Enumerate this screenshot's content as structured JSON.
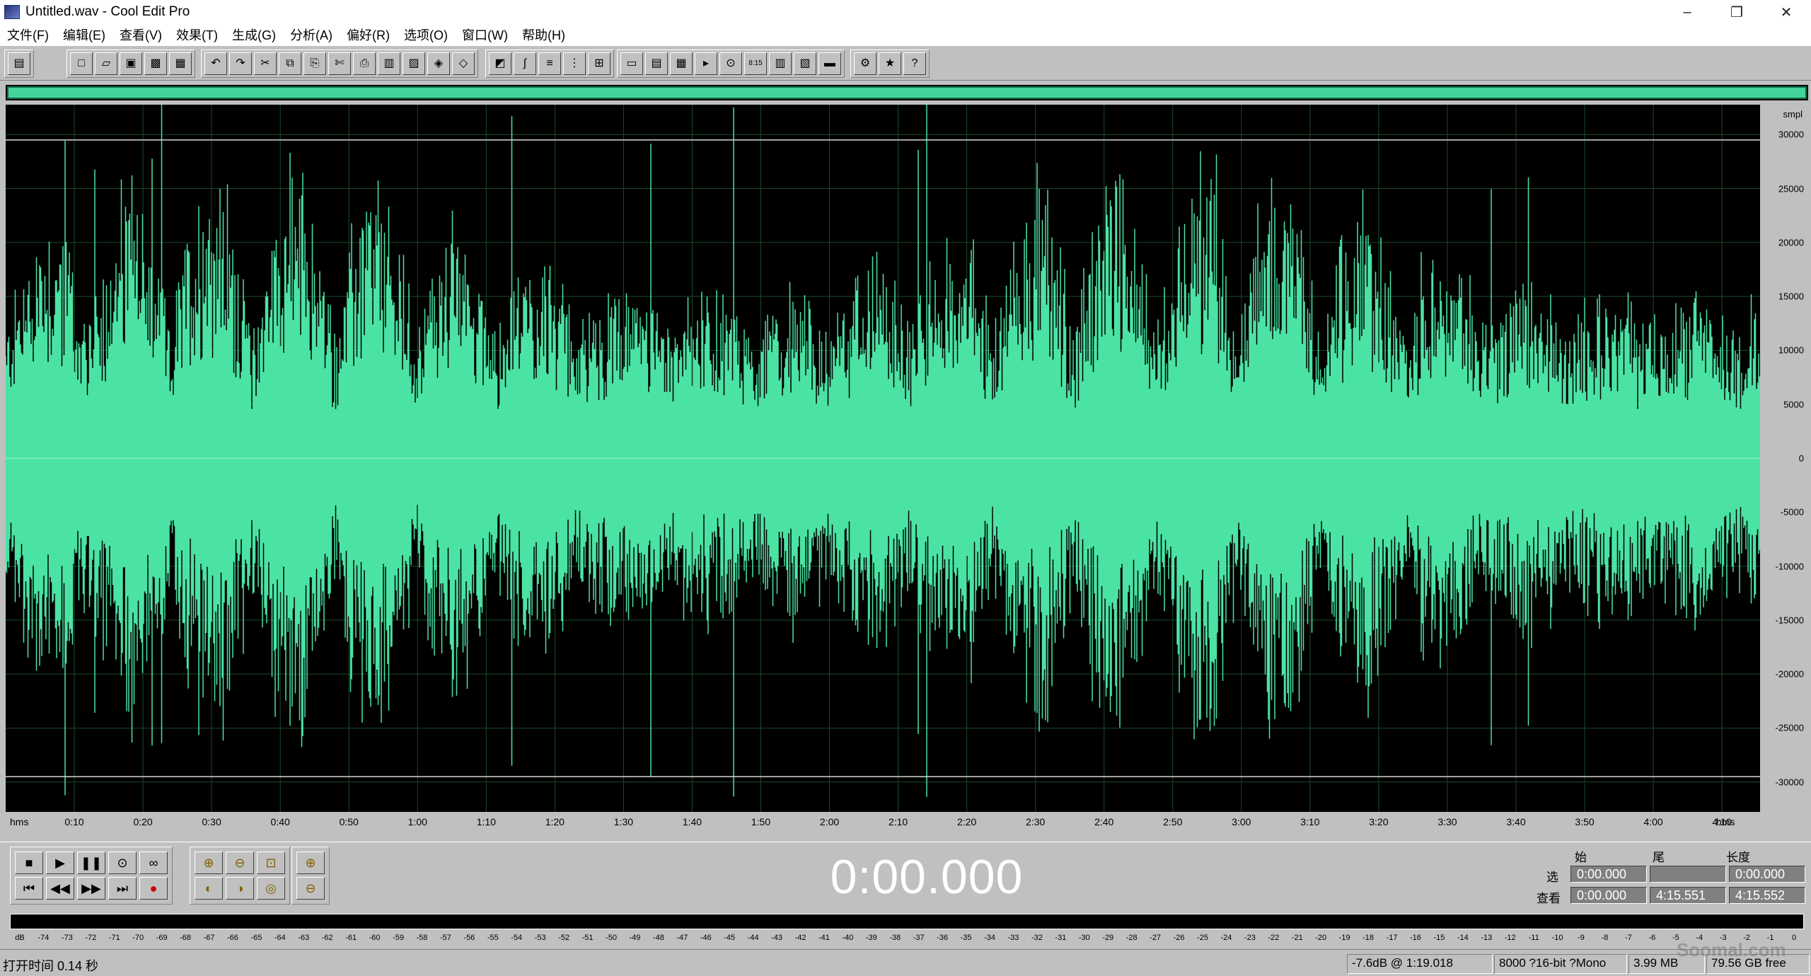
{
  "window": {
    "title": "Untitled.wav - Cool Edit Pro",
    "minimize": "–",
    "restore": "❐",
    "close": "✕"
  },
  "menu": [
    "文件(F)",
    "编辑(E)",
    "查看(V)",
    "效果(T)",
    "生成(G)",
    "分析(A)",
    "偏好(R)",
    "选项(O)",
    "窗口(W)",
    "帮助(H)"
  ],
  "toolbar_icons": {
    "group1": [
      "multitrack-icon"
    ],
    "group2": [
      "new-file-icon",
      "open-file-icon",
      "save-icon",
      "save-as-icon",
      "close-file-icon"
    ],
    "group3": [
      "undo-icon",
      "redo-icon",
      "repeat-icon",
      "copy-icon",
      "copy-to-new-icon",
      "cut-icon",
      "paste-icon",
      "paste-new-icon",
      "mix-paste-icon",
      "trim-icon",
      "cue-icon"
    ],
    "group4": [
      "spectral-view-icon",
      "envelope-icon",
      "insert-icon",
      "snap-icon",
      "grid-icon"
    ],
    "group5": [
      "cue-list-icon",
      "play-list-icon",
      "info-icon",
      "scripts-icon",
      "zoom-icon",
      "time-display-icon",
      "meter-icon",
      "mixer-icon",
      "vu-icon"
    ],
    "group6": [
      "settings-icon",
      "favorites-icon",
      "help-icon"
    ]
  },
  "toolbar_glyphs": {
    "multitrack-icon": "▤",
    "new-file-icon": "□",
    "open-file-icon": "▱",
    "save-icon": "▣",
    "save-as-icon": "▩",
    "close-file-icon": "▦",
    "undo-icon": "↶",
    "redo-icon": "↷",
    "repeat-icon": "✂",
    "copy-icon": "⧉",
    "copy-to-new-icon": "⎘",
    "cut-icon": "✄",
    "paste-icon": "⎙",
    "paste-new-icon": "▥",
    "mix-paste-icon": "▨",
    "trim-icon": "◈",
    "cue-icon": "◇",
    "spectral-view-icon": "◩",
    "envelope-icon": "∫",
    "insert-icon": "≡",
    "snap-icon": "⋮",
    "grid-icon": "⊞",
    "cue-list-icon": "▭",
    "play-list-icon": "▤",
    "info-icon": "▦",
    "scripts-icon": "▸",
    "zoom-icon": "⊙",
    "time-display-icon": "8:15",
    "meter-icon": "▥",
    "mixer-icon": "▧",
    "vu-icon": "▬",
    "settings-icon": "⚙",
    "favorites-icon": "★",
    "help-icon": "?"
  },
  "waveform": {
    "y_unit": "smpl",
    "y_ticks": [
      30000,
      25000,
      20000,
      15000,
      10000,
      5000,
      0,
      -5000,
      -10000,
      -15000,
      -20000,
      -25000,
      -30000
    ],
    "y_range": [
      -32768,
      32767
    ],
    "x_unit": "hms",
    "x_ticks": [
      "0:10",
      "0:20",
      "0:30",
      "0:40",
      "0:50",
      "1:00",
      "1:10",
      "1:20",
      "1:30",
      "1:40",
      "1:50",
      "2:00",
      "2:10",
      "2:20",
      "2:30",
      "2:40",
      "2:50",
      "3:00",
      "3:10",
      "3:20",
      "3:30",
      "3:40",
      "3:50",
      "4:00",
      "4:10"
    ],
    "duration_sec": 255.552,
    "color": "#4be3a4",
    "background": "#000000",
    "grid_color": "#1c4a2a",
    "clip_lines_smpl": [
      29500,
      -29500
    ]
  },
  "transport": {
    "row1": [
      {
        "name": "stop-icon",
        "glyph": "■"
      },
      {
        "name": "play-icon",
        "glyph": "▶"
      },
      {
        "name": "pause-icon",
        "glyph": "❚❚"
      },
      {
        "name": "play-to-end-icon",
        "glyph": "⊙"
      },
      {
        "name": "loop-icon",
        "glyph": "∞"
      }
    ],
    "row2": [
      {
        "name": "go-start-icon",
        "glyph": "⏮"
      },
      {
        "name": "rewind-icon",
        "glyph": "◀◀"
      },
      {
        "name": "fast-forward-icon",
        "glyph": "▶▶"
      },
      {
        "name": "go-end-icon",
        "glyph": "⏭"
      },
      {
        "name": "record-icon",
        "glyph": "●"
      }
    ]
  },
  "zoom": {
    "row1": [
      {
        "name": "zoom-in-icon",
        "glyph": "⊕"
      },
      {
        "name": "zoom-out-icon",
        "glyph": "⊖"
      },
      {
        "name": "zoom-full-icon",
        "glyph": "⊡"
      }
    ],
    "row2": [
      {
        "name": "zoom-left-icon",
        "glyph": "◐"
      },
      {
        "name": "zoom-right-icon",
        "glyph": "◑"
      },
      {
        "name": "zoom-selection-icon",
        "glyph": "◎"
      }
    ],
    "vert": [
      {
        "name": "zoom-in-vertical-icon",
        "glyph": "⊕"
      },
      {
        "name": "zoom-out-vertical-icon",
        "glyph": "⊖"
      }
    ]
  },
  "time_display": "0:00.000",
  "selection_panel": {
    "headers": [
      "始",
      "尾",
      "长度"
    ],
    "sel_label": "选",
    "view_label": "查看",
    "sel_begin": "0:00.000",
    "sel_end": "",
    "sel_length": "0:00.000",
    "view_begin": "0:00.000",
    "view_end": "4:15.551",
    "view_length": "4:15.552"
  },
  "level_meter": {
    "labels": [
      "dB",
      "-74",
      "-73",
      "-72",
      "-71",
      "-70",
      "-69",
      "-68",
      "-67",
      "-66",
      "-65",
      "-64",
      "-63",
      "-62",
      "-61",
      "-60",
      "-59",
      "-58",
      "-57",
      "-56",
      "-55",
      "-54",
      "-53",
      "-52",
      "-51",
      "-50",
      "-49",
      "-48",
      "-47",
      "-46",
      "-45",
      "-44",
      "-43",
      "-42",
      "-41",
      "-40",
      "-39",
      "-38",
      "-37",
      "-36",
      "-35",
      "-34",
      "-33",
      "-32",
      "-31",
      "-30",
      "-29",
      "-28",
      "-27",
      "-26",
      "-25",
      "-24",
      "-23",
      "-22",
      "-21",
      "-20",
      "-19",
      "-18",
      "-17",
      "-16",
      "-15",
      "-14",
      "-13",
      "-12",
      "-11",
      "-10",
      "-9",
      "-8",
      "-7",
      "-6",
      "-5",
      "-4",
      "-3",
      "-2",
      "-1",
      "0"
    ]
  },
  "status": {
    "open_time": "打开时间  0.14 秒",
    "level": "-7.6dB @  1:19.018",
    "format": "8000 ?16-bit ?Mono",
    "size": "3.99 MB",
    "free": "79.56 GB free"
  },
  "watermark": "Soomal.com"
}
